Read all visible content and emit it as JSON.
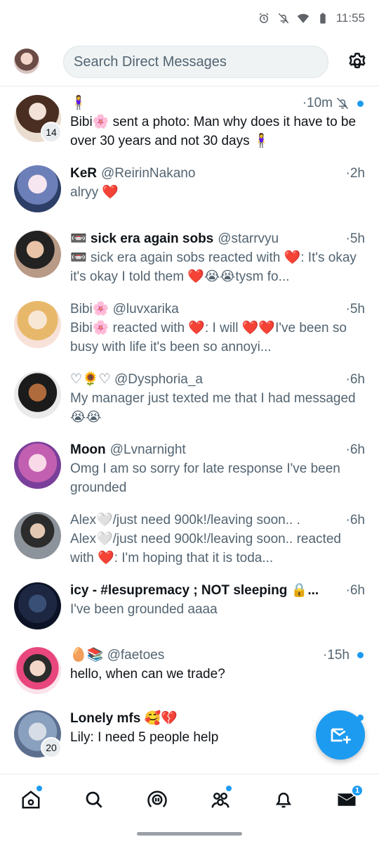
{
  "status_bar": {
    "time": "11:55"
  },
  "header": {
    "search_placeholder": "Search Direct Messages"
  },
  "conversations": [
    {
      "name": "",
      "handle": "🧍‍♀️",
      "time": "·10m",
      "message": "Bibi🌸 sent a photo: Man why does it have to be over 30 years and not 30 days 🧍‍♀️",
      "badge": "14",
      "unread": true,
      "muted": true
    },
    {
      "name": "KeR",
      "handle": "@ReirinNakano",
      "time": "·2h",
      "message": "alryy ❤️",
      "badge": "",
      "unread": false,
      "muted": false
    },
    {
      "name": "📼 sick era again sobs",
      "handle": "@starrvyu",
      "time": "·5h",
      "message": "📼 sick era again sobs reacted with ❤️: It's okay it's okay I told them ❤️😭😭tysm fo...",
      "badge": "",
      "unread": false,
      "muted": false
    },
    {
      "name": "",
      "handle": "Bibi🌸 @luvxarika",
      "time": "·5h",
      "message": "Bibi🌸 reacted with ❤️: I will ❤️❤️I've been so busy with life it's been so annoyi...",
      "badge": "",
      "unread": false,
      "muted": false
    },
    {
      "name": "",
      "handle": "♡🌻♡ @Dysphoria_a",
      "time": "·6h",
      "message": "My manager just texted me that I had messaged 😭😭",
      "badge": "",
      "unread": false,
      "muted": false
    },
    {
      "name": "Moon",
      "handle": "@Lvnarnight",
      "time": "·6h",
      "message": "Omg I am so sorry for late response I've been grounded",
      "badge": "",
      "unread": false,
      "muted": false
    },
    {
      "name": "",
      "handle": "Alex🤍/just need 900k!/leaving soon.. .",
      "time": "·6h",
      "message": "Alex🤍/just need 900k!/leaving soon.. reacted with ❤️: I'm hoping that it is toda...",
      "badge": "",
      "unread": false,
      "muted": false
    },
    {
      "name": "icy - #lesupremacy ; NOT sleeping 🔒...",
      "handle": "",
      "time": "·6h",
      "message": "I've been grounded aaaa",
      "badge": "",
      "unread": false,
      "muted": false
    },
    {
      "name": "",
      "handle": "🥚📚 @faetoes",
      "time": "·15h",
      "message": "hello, when can we trade?",
      "badge": "",
      "unread": true,
      "muted": false
    },
    {
      "name": "Lonely mfs 🥰💔",
      "handle": "",
      "time": "",
      "message": "Lily: I need 5 people help",
      "badge": "20",
      "unread": true,
      "muted": false
    }
  ],
  "bottom_nav": {
    "items": [
      "home-icon",
      "search-icon",
      "spaces-icon",
      "communities-icon",
      "notifications-icon",
      "messages-icon"
    ],
    "messages_count": "1"
  },
  "colors": {
    "accent": "#1d9bf0",
    "text": "#0f1419",
    "muted_text": "#536471"
  }
}
